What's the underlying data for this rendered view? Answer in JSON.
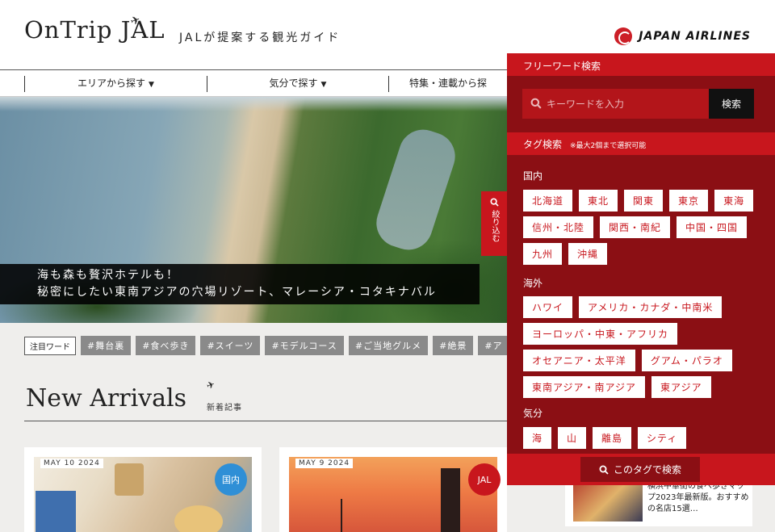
{
  "header": {
    "logo": "OnTrip JAL",
    "tagline": "JALが提案する観光ガイド",
    "airline": "JAPAN AIRLINES"
  },
  "nav": {
    "items": [
      "エリアから探す",
      "気分で探す",
      "特集・連載から探"
    ]
  },
  "hero": {
    "caption_line1": "海も森も贅沢ホテルも！",
    "caption_line2": "秘密にしたい東南アジアの穴場リゾート、マレーシア・コタキナバル",
    "side_tab": "絞り込む"
  },
  "attention": {
    "label": "注目ワード",
    "tags": [
      "#舞台裏",
      "#食べ歩き",
      "#スイーツ",
      "#モデルコース",
      "#ご当地グルメ",
      "#絶景",
      "#ア"
    ]
  },
  "new_arrivals": {
    "title": "New Arrivals",
    "subtitle": "新着記事",
    "cards": [
      {
        "date": "MAY 10 2024",
        "badge": "国内",
        "badge_color": "#2f8fd6"
      },
      {
        "date": "MAY 9 2024",
        "badge": "JAL",
        "badge_color": "#c8161d"
      }
    ]
  },
  "news": {
    "text": "横浜中華街の食べ歩きマップ2023年最新版。おすすめの名店15選…"
  },
  "panel": {
    "freeword_title": "フリーワード検索",
    "search_placeholder": "キーワードを入力",
    "search_button": "検索",
    "tag_title": "タグ検索",
    "tag_note": "※最大2個まで選択可能",
    "groups": [
      {
        "label": "国内",
        "tags": [
          "北海道",
          "東北",
          "関東",
          "東京",
          "東海",
          "信州・北陸",
          "関西・南紀",
          "中国・四国",
          "九州",
          "沖縄"
        ]
      },
      {
        "label": "海外",
        "tags": [
          "ハワイ",
          "アメリカ・カナダ・中南米",
          "ヨーロッパ・中東・アフリカ",
          "オセアニア・太平洋",
          "グアム・パラオ",
          "東南アジア・南アジア",
          "東アジア"
        ]
      },
      {
        "label": "気分",
        "tags": [
          "海",
          "山",
          "離島",
          "シティ"
        ]
      }
    ],
    "submit": "このタグで検索"
  },
  "colors": {
    "jal_red": "#c8161d",
    "panel_dark_red": "#8b0f14"
  }
}
